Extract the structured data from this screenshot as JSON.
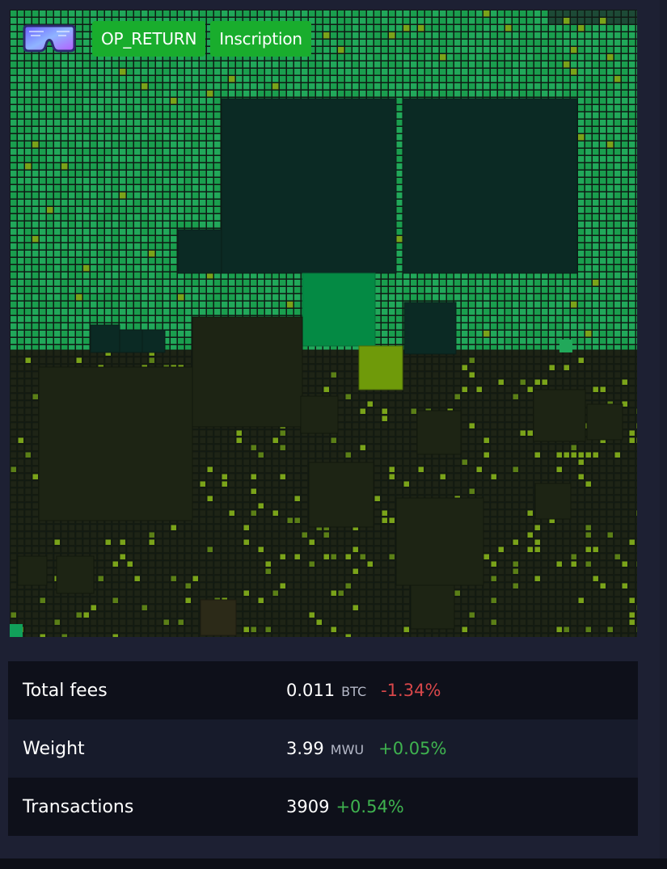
{
  "block_visualization": {
    "tags": [
      "OP_RETURN",
      "Inscription"
    ],
    "colors": {
      "tx_high": "#1a9e4e",
      "tx_high_alt": "#21a85a",
      "tx_mid": "#1e2416",
      "tx_lime": "#7aa31a",
      "tx_large_dark": "#0b2a24",
      "tag_background": "#19ad2d"
    },
    "icons": [
      "goggles-icon"
    ]
  },
  "stats": [
    {
      "label": "Total fees",
      "value": "0.011",
      "unit": "BTC",
      "change": "-1.34%",
      "change_color": "#d8474a"
    },
    {
      "label": "Weight",
      "value": "3.99",
      "unit": "MWU",
      "change": "+0.05%",
      "change_color": "#3fb34f"
    },
    {
      "label": "Transactions",
      "value": "3909",
      "unit": "",
      "change": "+0.54%",
      "change_color": "#3fb34f"
    }
  ]
}
